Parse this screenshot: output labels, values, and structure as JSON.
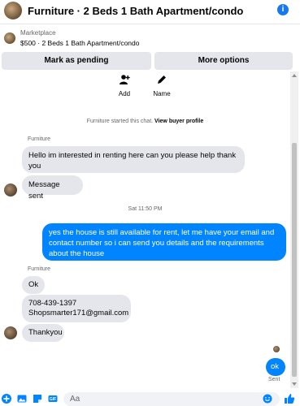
{
  "header": {
    "title": "Furniture · 2 Beds 1 Bath Apartment/condo",
    "info_icon": "info-icon"
  },
  "marketplace": {
    "label": "Marketplace",
    "listing": "$500 · 2 Beds 1 Bath Apartment/condo"
  },
  "actions_bar": {
    "pending_label": "Mark as pending",
    "more_label": "More options"
  },
  "quick_actions": [
    {
      "label": "Add",
      "icon": "add-person-icon"
    },
    {
      "label": "Name",
      "icon": "pencil-icon"
    }
  ],
  "chat": {
    "started_prefix": "Furniture started this chat.",
    "started_link": "View buyer profile",
    "timestamp": "Sat 11:50 PM",
    "sender_name": "Furniture",
    "messages": [
      {
        "from": "them",
        "text": "Hello im interested in renting here can you please help thank you"
      },
      {
        "from": "them",
        "text": "Message sent"
      },
      {
        "from": "me",
        "text": "yes the house is still available for rent, let me have your email  and contact number so i can send you details and the requirements about the house"
      },
      {
        "from": "them",
        "text": "Ok"
      },
      {
        "from": "them",
        "text": "708-439-1397\nShopsmarter171@gmail.com"
      },
      {
        "from": "them",
        "text": "Thankyou"
      },
      {
        "from": "me",
        "text": "ok"
      }
    ],
    "status": "Sent"
  },
  "composer": {
    "placeholder": "Aa",
    "icons": [
      "plus-icon",
      "photo-icon",
      "sticker-icon",
      "gif-icon",
      "emoji-icon",
      "like-icon"
    ]
  },
  "colors": {
    "accent": "#0084ff",
    "bubble_other": "#e4e6eb",
    "button_bg": "#e4e6eb"
  }
}
